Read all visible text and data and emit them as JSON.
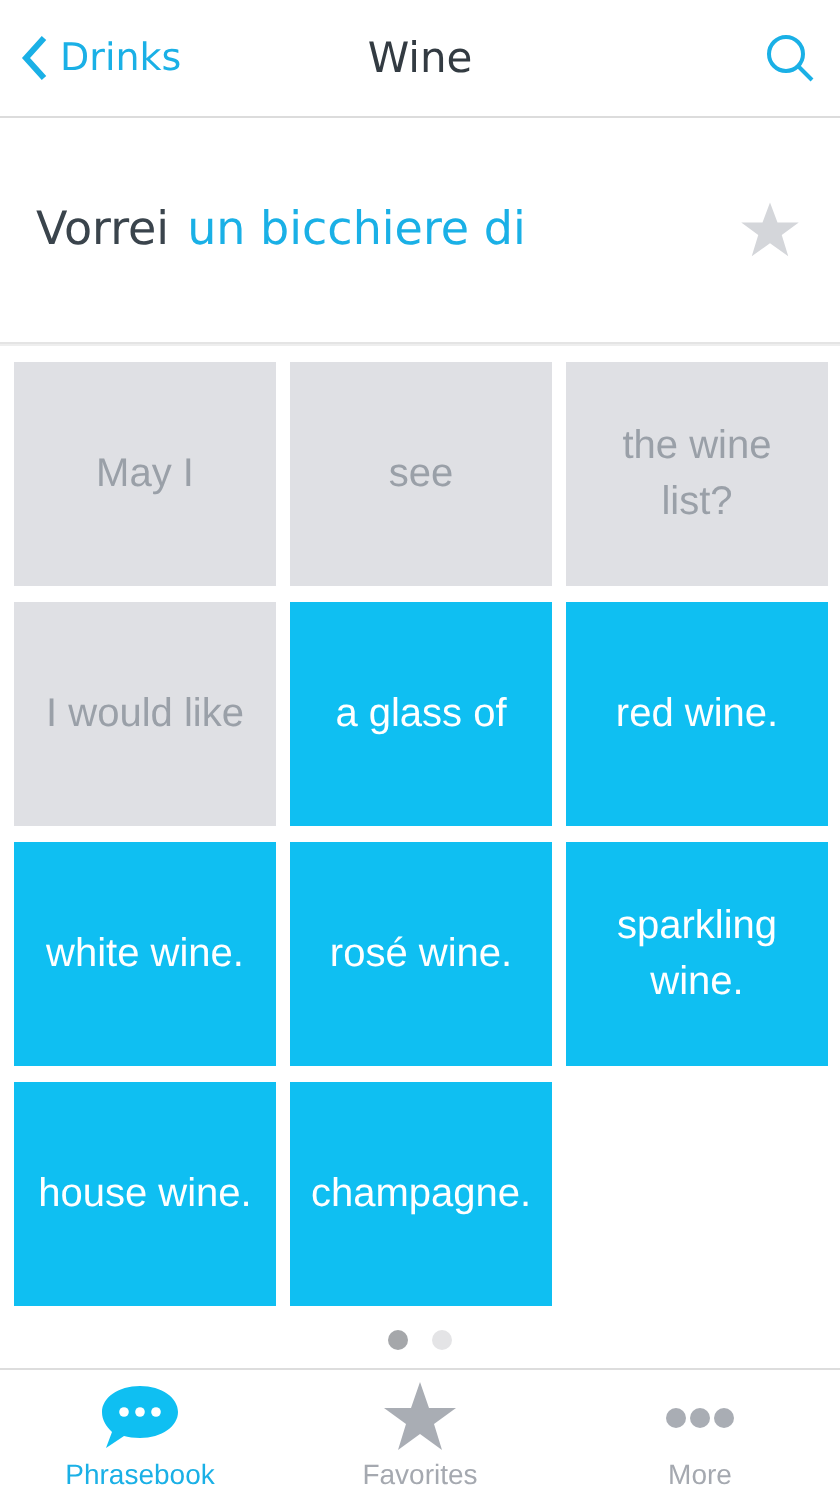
{
  "nav": {
    "back": "Drinks",
    "title": "Wine"
  },
  "phrase": {
    "parts": [
      {
        "text": "Vorrei",
        "highlighted": false
      },
      {
        "text": "un bicchiere di",
        "highlighted": true
      }
    ],
    "favorite": false
  },
  "tiles": [
    {
      "text": "May I",
      "selected": false
    },
    {
      "text": "see",
      "selected": false
    },
    {
      "text": "the wine list?",
      "selected": false
    },
    {
      "text": "I would like",
      "selected": false
    },
    {
      "text": "a glass of",
      "selected": true
    },
    {
      "text": "red wine.",
      "selected": true
    },
    {
      "text": "white wine.",
      "selected": true
    },
    {
      "text": "rosé wine.",
      "selected": true
    },
    {
      "text": "sparkling wine.",
      "selected": true
    },
    {
      "text": "house wine.",
      "selected": true
    },
    {
      "text": "champagne.",
      "selected": true
    }
  ],
  "pages": [
    {
      "selected": true
    },
    {
      "selected": false
    }
  ],
  "tabs": [
    {
      "kind": "phrasebook",
      "label": "Phrasebook",
      "selected": true
    },
    {
      "kind": "favorites",
      "label": "Favorites",
      "selected": false
    },
    {
      "kind": "more",
      "label": "More",
      "selected": false
    }
  ]
}
